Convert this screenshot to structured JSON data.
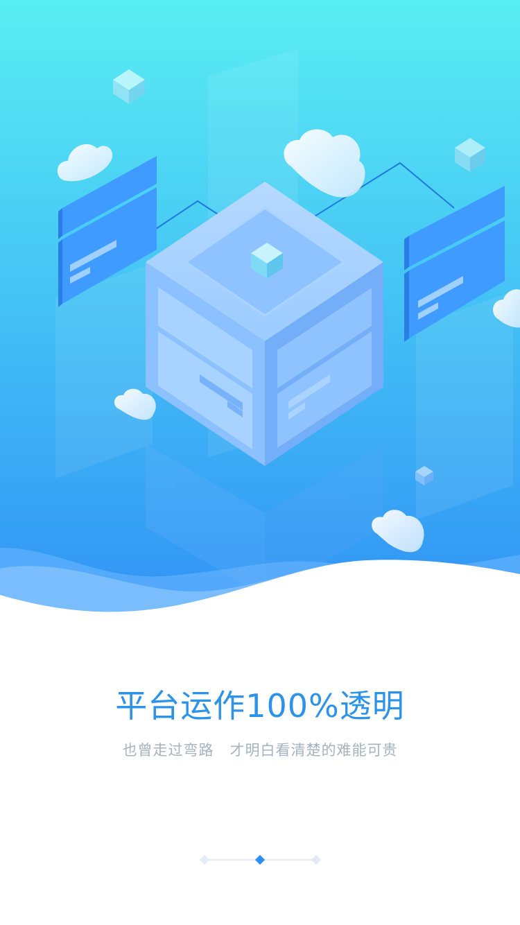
{
  "onboarding": {
    "title": "平台运作100%透明",
    "subtitle": "也曾走过弯路   才明白看清楚的难能可贵"
  },
  "pagination": {
    "total": 3,
    "active_index": 1
  },
  "colors": {
    "accent": "#2c93ea",
    "subtitle": "#a4b2c2",
    "gradient_top": "#59eef2",
    "gradient_bottom": "#2f8ff5",
    "dot_active": "#2f8ff5",
    "dot_inactive": "#e3ecf6"
  }
}
